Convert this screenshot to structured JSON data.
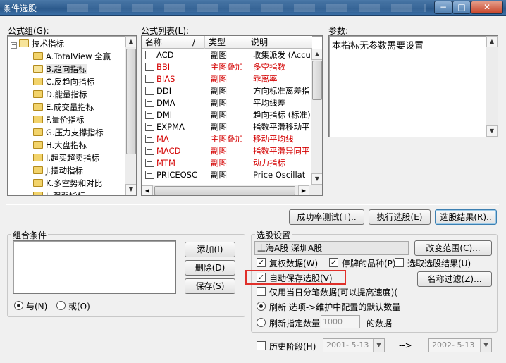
{
  "window": {
    "title": "条件选股",
    "min": "−",
    "max": "□",
    "close": "✕"
  },
  "formula_group": {
    "label": "公式组(G):",
    "root": "技术指标",
    "items": [
      "A.TotalView 全赢",
      "B.趋向指标",
      "C.反趋向指标",
      "D.能量指标",
      "E.成交量指标",
      "F.量价指标",
      "G.压力支撑指标",
      "H.大盘指标",
      "I.超买超卖指标",
      "J.摆动指标",
      "K.多空势和对比",
      "L.强弱指标"
    ]
  },
  "formula_list": {
    "label": "公式列表(L):",
    "columns": [
      "名称",
      "/",
      "类型",
      "说明"
    ],
    "rows": [
      {
        "name": "ACD",
        "type": "副图",
        "desc": "收集派发 (Accu",
        "red": false
      },
      {
        "name": "BBI",
        "type": "主图叠加",
        "desc": "多空指数",
        "red": true
      },
      {
        "name": "BIAS",
        "type": "副图",
        "desc": "乖离率",
        "red": true
      },
      {
        "name": "DDI",
        "type": "副图",
        "desc": "方向标准离差指",
        "red": false
      },
      {
        "name": "DMA",
        "type": "副图",
        "desc": "平均线差",
        "red": false
      },
      {
        "name": "DMI",
        "type": "副图",
        "desc": "趋向指标 (标准)",
        "red": false
      },
      {
        "name": "EXPMA",
        "type": "副图",
        "desc": "指数平滑移动平",
        "red": false
      },
      {
        "name": "MA",
        "type": "主图叠加",
        "desc": "移动平均线",
        "red": true
      },
      {
        "name": "MACD",
        "type": "副图",
        "desc": "指数平滑异同平",
        "red": true
      },
      {
        "name": "MTM",
        "type": "副图",
        "desc": "动力指标",
        "red": true
      },
      {
        "name": "PRICEOSC",
        "type": "副图",
        "desc": "Price Oscillat",
        "red": false
      }
    ]
  },
  "params": {
    "label": "参数:",
    "text": "本指标无参数需要设置"
  },
  "top_buttons": {
    "success_test": "成功率测试(T)..",
    "execute": "执行选股(E)",
    "results": "选股结果(R).."
  },
  "combo": {
    "title": "组合条件",
    "add": "添加(I)",
    "delete": "删除(D)",
    "save": "保存(S)",
    "and_label": "与(N)",
    "or_label": "或(O)"
  },
  "settings": {
    "title": "选股设置",
    "markets": "上海A股  深圳A股",
    "change_range": "改变范围(C)...",
    "restore_rights": "复权数据(W)",
    "suspended": "停牌的品种(P)",
    "pick_results": "选取选股结果(U)",
    "auto_save": "自动保存选股(V)",
    "name_filter": "名称过滤(Z)...",
    "today_tick": "仅用当日分笔数据(可以提高速度)(",
    "refresh_default": "刷新 选项->维护中配置的默认数量",
    "refresh_count_label": "刷新指定数量",
    "refresh_count_value": "1000",
    "refresh_count_suffix": "的数据",
    "history_label": "历史阶段(H)",
    "date_from": "2001- 5-13",
    "arrow": "-->",
    "date_to": "2002- 5-13"
  }
}
